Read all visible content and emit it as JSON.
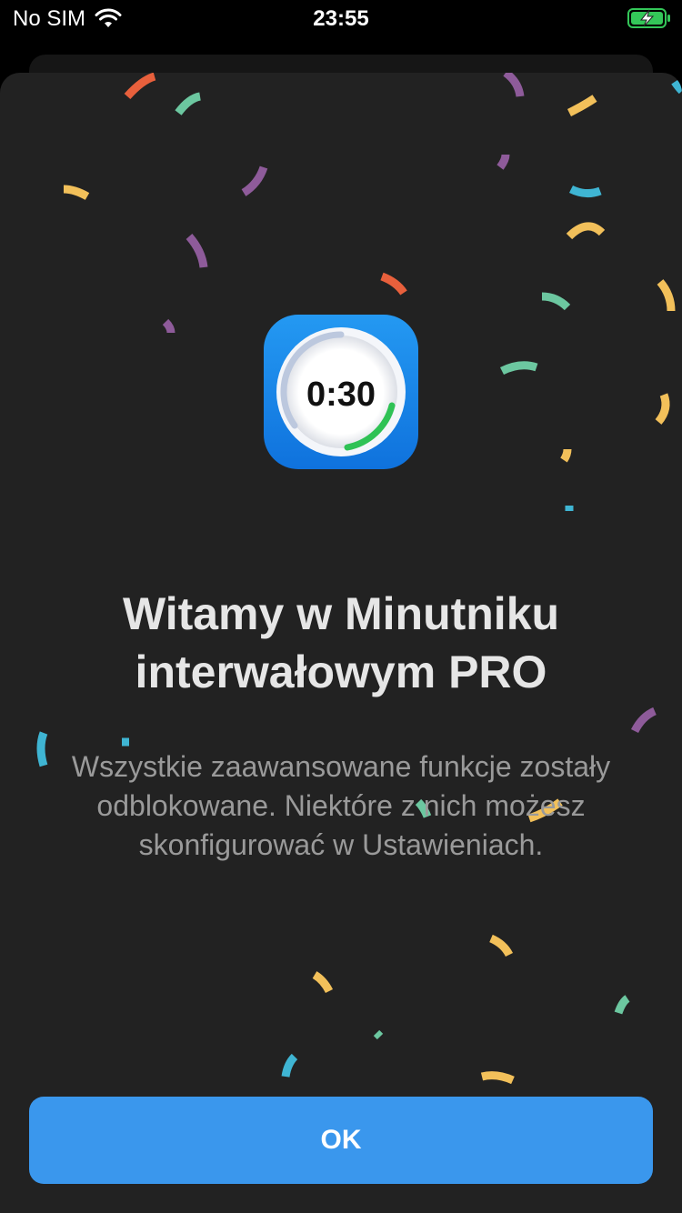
{
  "status_bar": {
    "carrier": "No SIM",
    "time": "23:55",
    "wifi_icon": "wifi-icon",
    "battery_icon": "battery-charging-icon"
  },
  "app_icon": {
    "icon": "timer-app-icon",
    "time_text": "0:30"
  },
  "welcome": {
    "title_line1": "Witamy w Minutniku",
    "title_line2": "interwałowym PRO",
    "subtitle": "Wszystkie zaawansowane funkcje zostały odblokowane. Niektóre z nich możesz skonfigurować w Ustawieniach."
  },
  "ok_button": {
    "label": "OK"
  },
  "colors": {
    "sheet_background": "#222222",
    "accent_button": "#3a97ed",
    "title": "#e6e6e6",
    "subtitle": "#9a9a9a",
    "battery_green": "#34c759",
    "icon_blue": "#1a87eb",
    "confetti": [
      "#e8603c",
      "#6cc7a0",
      "#8e5b9a",
      "#f2c05a",
      "#3fb5d3"
    ]
  }
}
